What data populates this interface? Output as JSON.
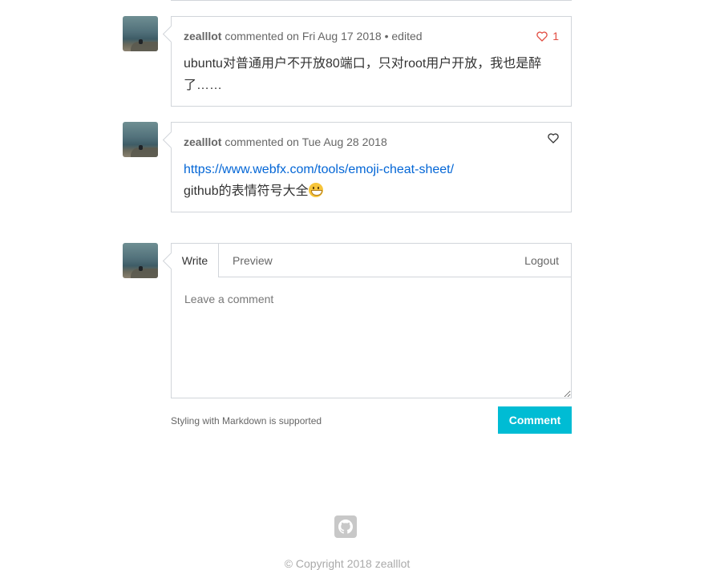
{
  "comments": [
    {
      "author": "zealllot",
      "meta": "commented on Fri Aug 17 2018 • edited",
      "likes": "1",
      "liked": true,
      "body_text": "ubuntu对普通用户不开放80端口，只对root用户开放，我也是醉了……"
    },
    {
      "author": "zealllot",
      "meta": "commented on Tue Aug 28 2018",
      "likes": "",
      "liked": false,
      "link": "https://www.webfx.com/tools/emoji-cheat-sheet/",
      "body_text": "github的表情符号大全"
    }
  ],
  "editor": {
    "tab_write": "Write",
    "tab_preview": "Preview",
    "logout": "Logout",
    "placeholder": "Leave a comment",
    "markdown_note": "Styling with Markdown is supported",
    "submit_label": "Comment"
  },
  "footer": {
    "copyright": "© Copyright 2018 zealllot"
  },
  "colors": {
    "accent": "#00bcd4",
    "like": "#e24d42",
    "link": "#0366d6"
  }
}
